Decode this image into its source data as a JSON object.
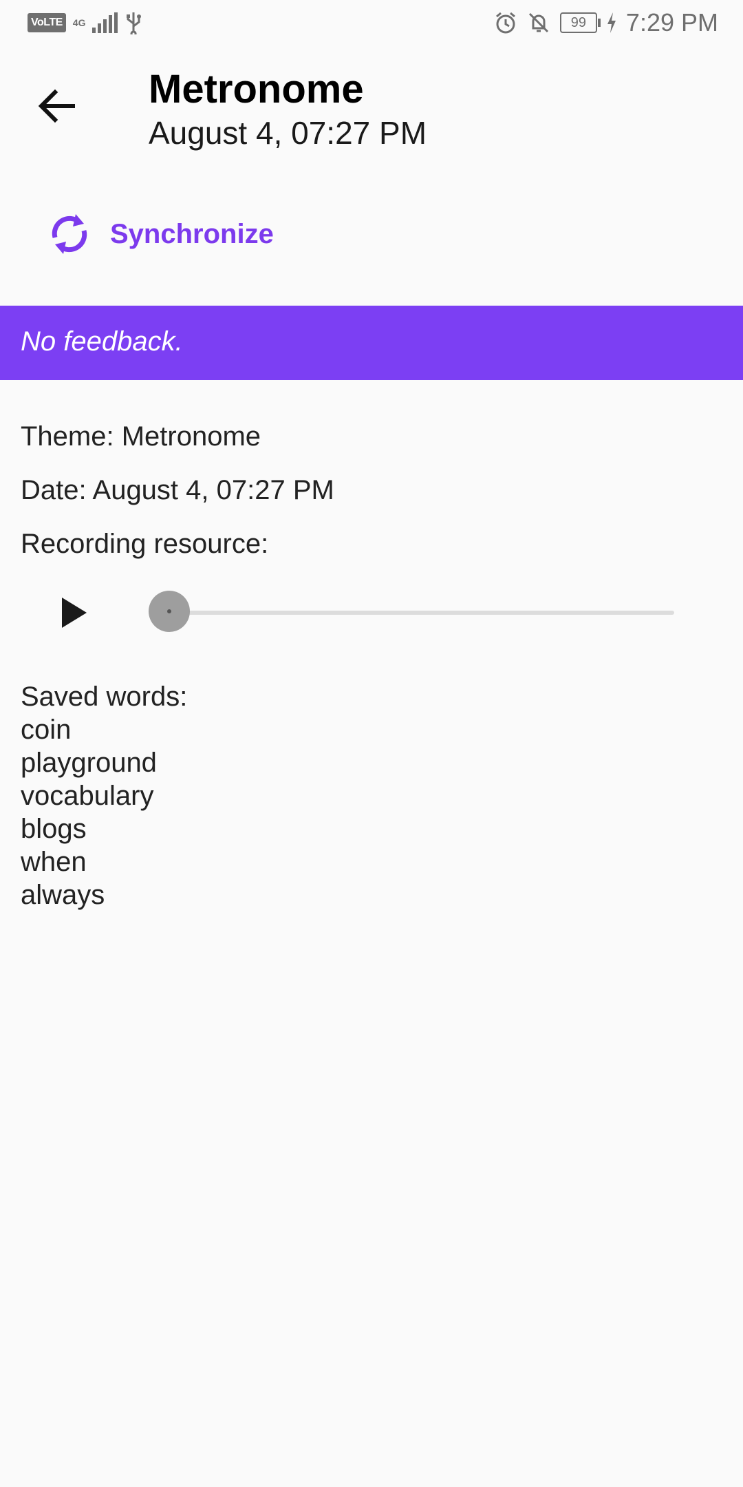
{
  "status_bar": {
    "volte": "VoLTE",
    "network": "4G",
    "battery": "99",
    "time": "7:29 PM",
    "icons": [
      "usb-icon",
      "alarm-icon",
      "notifications-off-icon",
      "charging-icon"
    ]
  },
  "app_bar": {
    "title": "Metronome",
    "subtitle": "August 4, 07:27 PM"
  },
  "sync": {
    "label": "Synchronize",
    "color": "#7c3aed"
  },
  "feedback": {
    "text": "No feedback.",
    "color": "#7c3ff3"
  },
  "details": {
    "theme": "Theme: Metronome",
    "date": "Date: August 4, 07:27 PM",
    "recording_label": "Recording resource:"
  },
  "player": {
    "progress": 0
  },
  "saved_words": {
    "label": "Saved words:",
    "words": [
      "coin",
      "playground",
      "vocabulary",
      "blogs",
      "when",
      "always"
    ]
  }
}
